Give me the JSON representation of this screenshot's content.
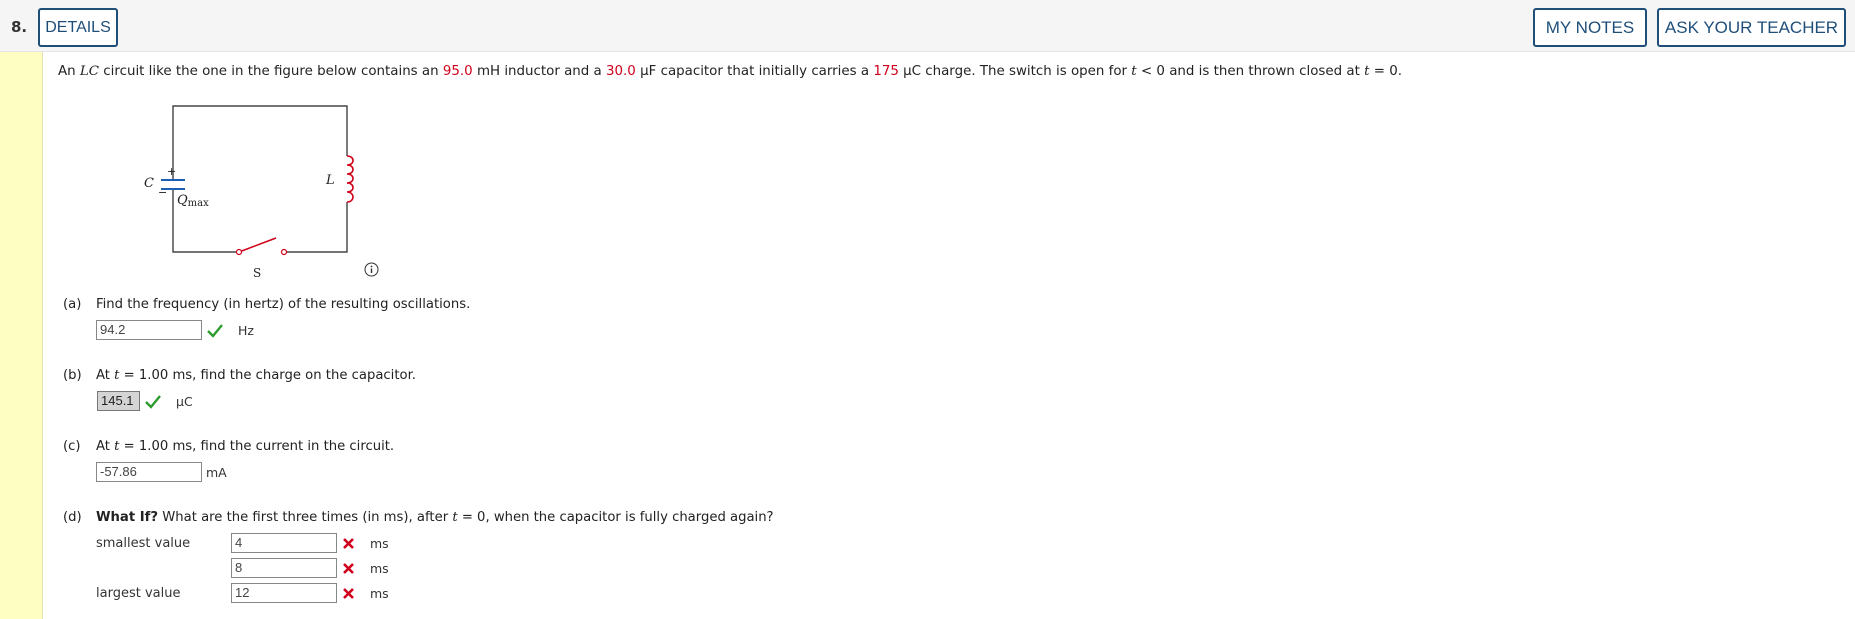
{
  "header": {
    "question_number": "8.",
    "details_label": "DETAILS",
    "my_notes_label": "MY NOTES",
    "ask_teacher_label": "ASK YOUR TEACHER"
  },
  "intro": {
    "t1": "An ",
    "lc": "LC",
    "t2": " circuit like the one in the figure below contains an ",
    "inductance": "95.0",
    "t3": " mH inductor and a ",
    "capacitance": "30.0",
    "t4": " µF capacitor that initially carries a ",
    "charge": "175",
    "t5": " µC charge. The switch is open for ",
    "tvar1": "t",
    "t6": " < 0 and is then thrown closed at ",
    "tvar2": "t",
    "t7": " = 0."
  },
  "figure": {
    "c_label": "C",
    "l_label": "L",
    "s_label": "S",
    "plus": "+",
    "minus": "−",
    "qmax_q": "Q",
    "qmax_sub": "max"
  },
  "parts": {
    "a": {
      "label": "(a)",
      "question": "Find the frequency (in hertz) of the resulting oscillations.",
      "answer": "94.2",
      "unit": "Hz"
    },
    "b": {
      "label": "(b)",
      "q1": "At ",
      "tvar": "t",
      "q2": " = 1.00 ms, find the charge on the capacitor.",
      "answer": "145.1",
      "unit": "µC"
    },
    "c": {
      "label": "(c)",
      "q1": "At ",
      "tvar": "t",
      "q2": " = 1.00 ms, find the current in the circuit.",
      "answer": "-57.86",
      "unit": "mA"
    },
    "d": {
      "label": "(d)",
      "bold": "What If?",
      "q1": " What are the first three times (in ms), after ",
      "tvar": "t",
      "q2": " = 0, when the capacitor is fully charged again?",
      "smallest_label": "smallest value",
      "largest_label": "largest value",
      "answers": [
        "4",
        "8",
        "12"
      ],
      "unit": "ms"
    }
  },
  "colors": {
    "accent": "#1f4e79",
    "highlight": "#d0021b",
    "correct": "#2e9b2e",
    "incorrect": "#d0021b"
  }
}
